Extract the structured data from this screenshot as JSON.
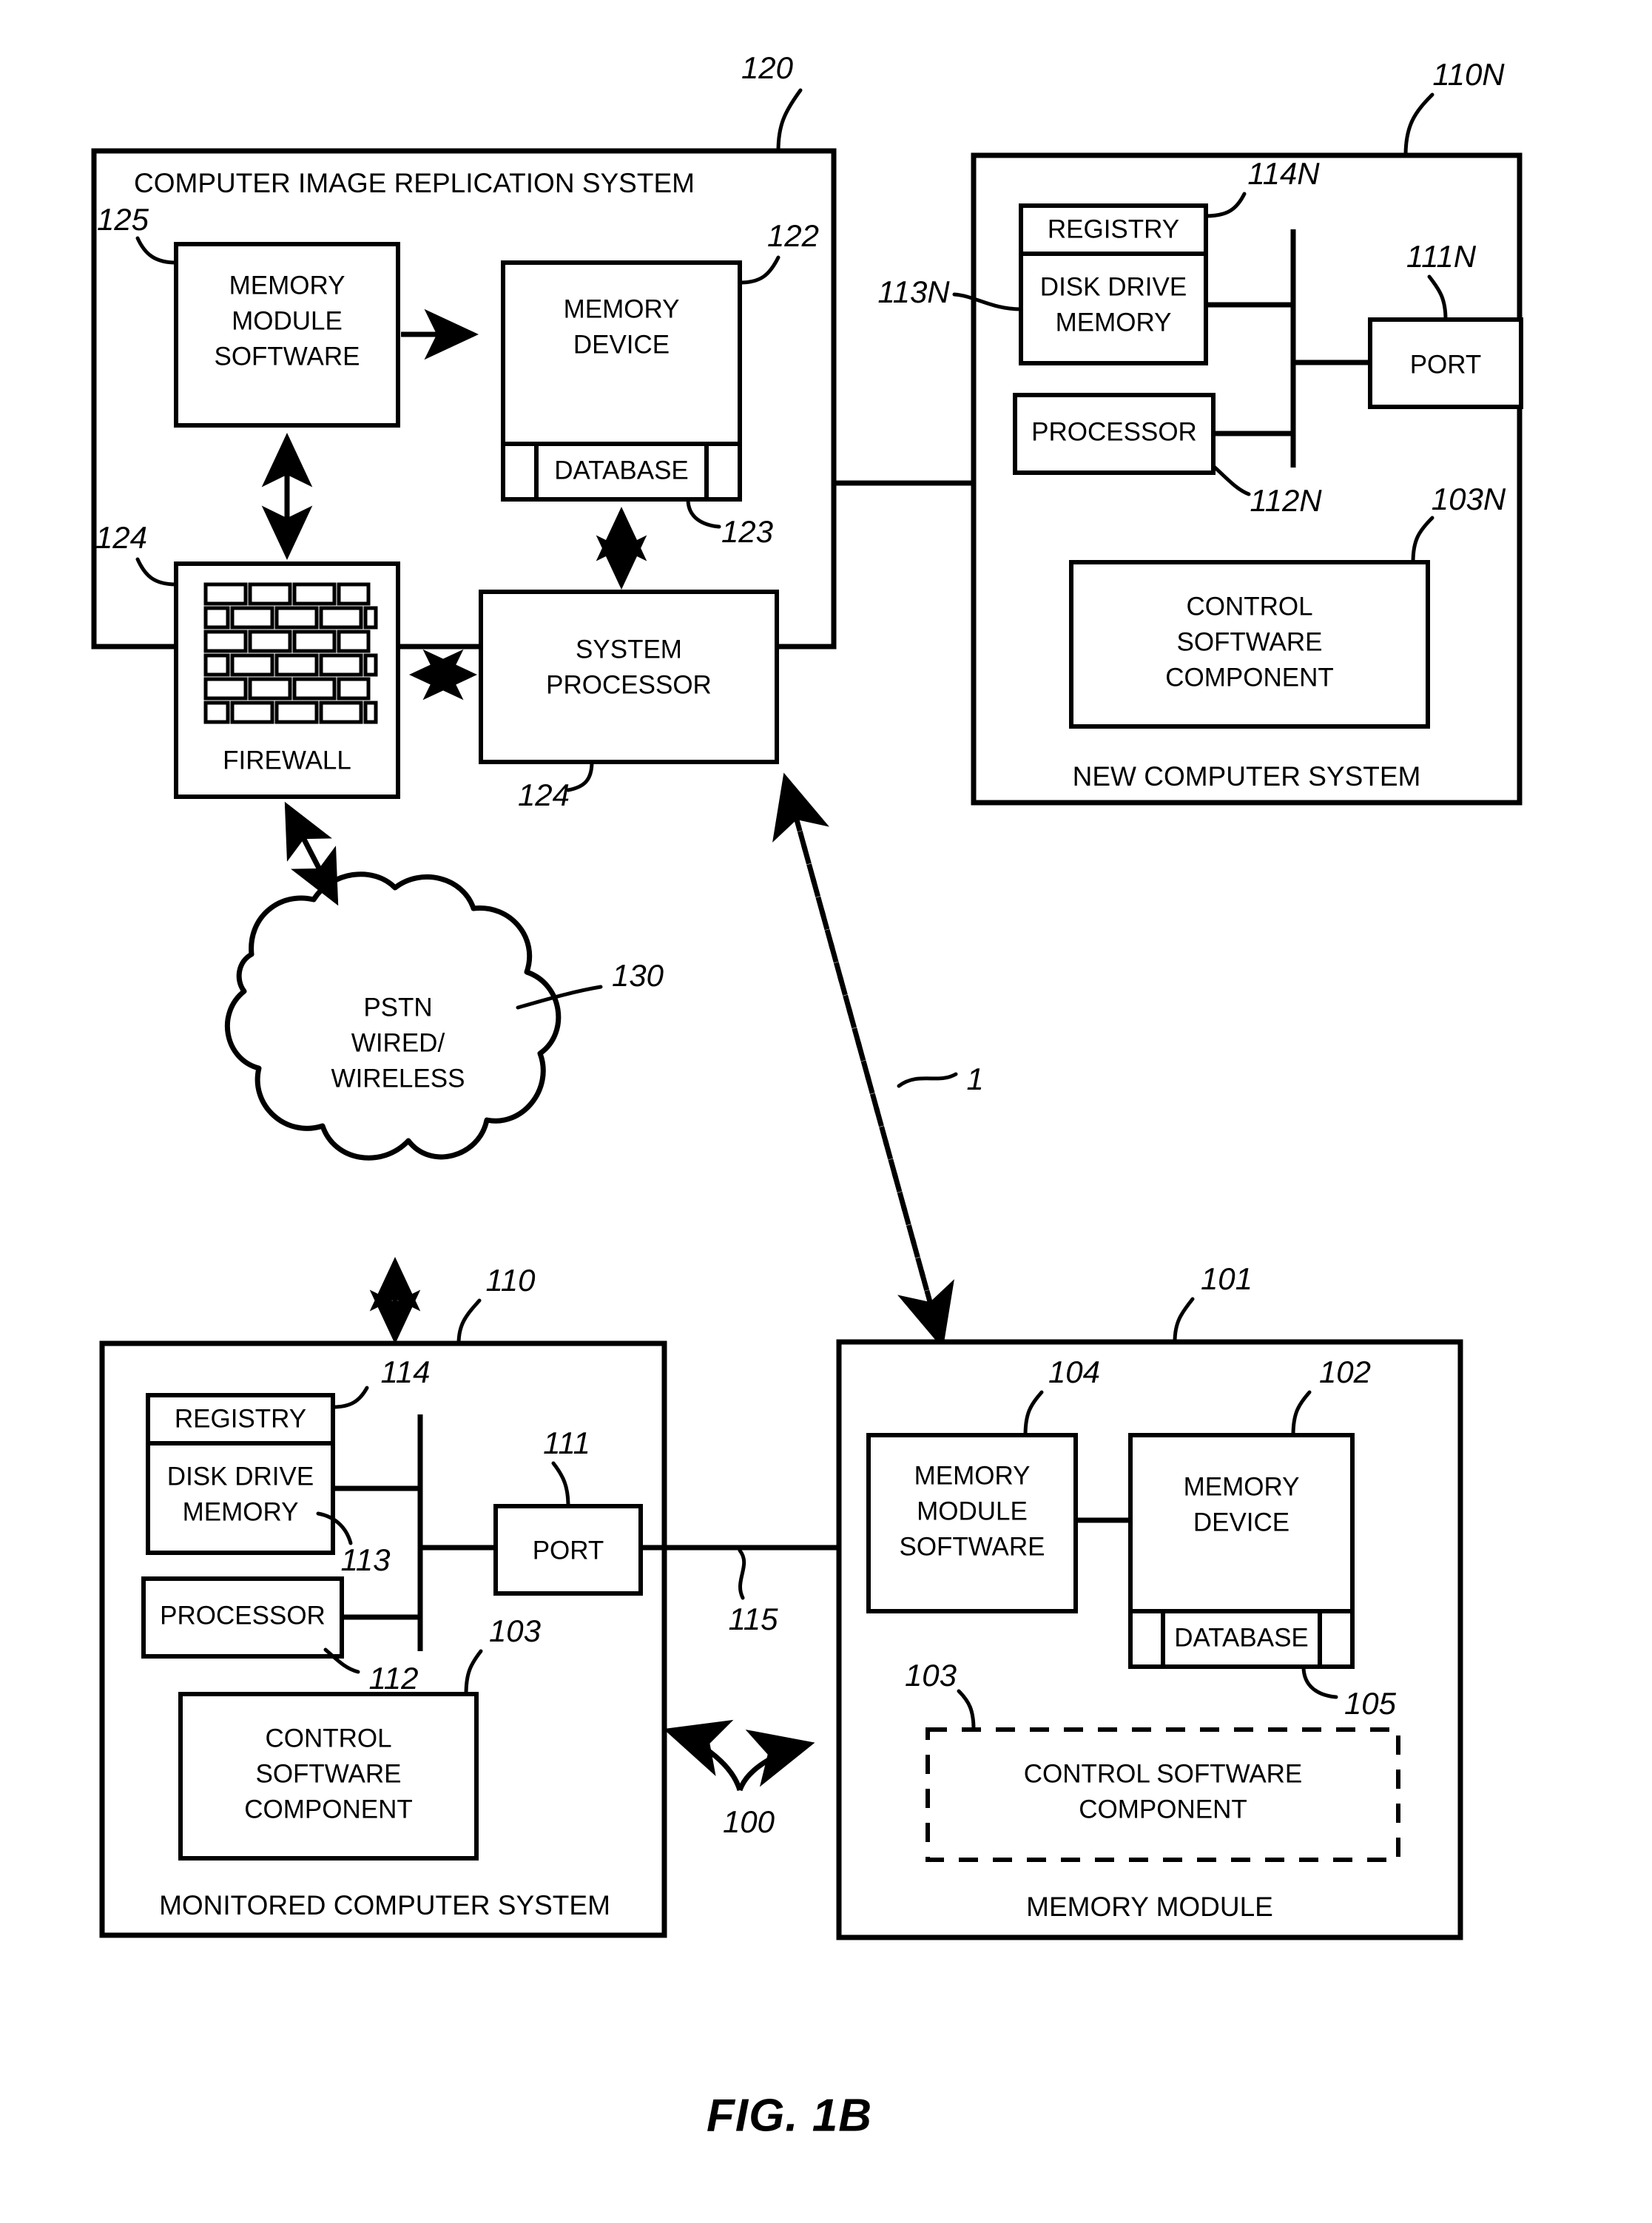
{
  "figure": {
    "caption": "FIG. 1B"
  },
  "systems": {
    "replication": {
      "title": "COMPUTER IMAGE REPLICATION SYSTEM",
      "ref": "120",
      "blocks": {
        "memory_module_software": {
          "lines": [
            "MEMORY",
            "MODULE",
            "SOFTWARE"
          ],
          "ref": "125"
        },
        "memory_device": {
          "lines": [
            "MEMORY",
            "DEVICE"
          ],
          "ref": "122"
        },
        "database": {
          "label": "DATABASE",
          "ref": "123"
        },
        "firewall": {
          "label": "FIREWALL",
          "ref": "124"
        },
        "system_processor": {
          "lines": [
            "SYSTEM",
            "PROCESSOR"
          ],
          "ref": "124"
        }
      }
    },
    "new_computer": {
      "title": "NEW COMPUTER SYSTEM",
      "ref": "110N",
      "blocks": {
        "registry": {
          "label": "REGISTRY",
          "ref": "114N"
        },
        "disk_drive_memory": {
          "lines": [
            "DISK DRIVE",
            "MEMORY"
          ],
          "ref": "113N"
        },
        "processor": {
          "label": "PROCESSOR",
          "ref": "112N"
        },
        "port": {
          "label": "PORT",
          "ref": "111N"
        },
        "control_software": {
          "lines": [
            "CONTROL",
            "SOFTWARE",
            "COMPONENT"
          ],
          "ref": "103N"
        }
      }
    },
    "monitored_computer": {
      "title": "MONITORED COMPUTER SYSTEM",
      "ref": "110",
      "blocks": {
        "registry": {
          "label": "REGISTRY",
          "ref": "114"
        },
        "disk_drive_memory": {
          "lines": [
            "DISK DRIVE",
            "MEMORY"
          ],
          "ref": "113"
        },
        "processor": {
          "label": "PROCESSOR",
          "ref": "112"
        },
        "port": {
          "label": "PORT",
          "ref": "111"
        },
        "control_software": {
          "lines": [
            "CONTROL",
            "SOFTWARE",
            "COMPONENT"
          ],
          "ref": "103"
        }
      }
    },
    "memory_module": {
      "title": "MEMORY MODULE",
      "ref": "101",
      "blocks": {
        "memory_module_software": {
          "lines": [
            "MEMORY",
            "MODULE",
            "SOFTWARE"
          ],
          "ref": "104"
        },
        "memory_device": {
          "lines": [
            "MEMORY",
            "DEVICE"
          ],
          "ref": "102"
        },
        "database": {
          "label": "DATABASE",
          "ref": "105"
        },
        "control_software": {
          "lines": [
            "CONTROL SOFTWARE",
            "COMPONENT"
          ],
          "ref": "103"
        }
      }
    }
  },
  "network": {
    "cloud": {
      "lines": [
        "PSTN",
        "WIRED/",
        "WIRELESS"
      ],
      "ref": "130"
    }
  },
  "connections": {
    "link_port_to_memory_module": {
      "ref": "115"
    },
    "system_overall": {
      "ref": "100"
    },
    "replication_link": {
      "ref": "1"
    }
  }
}
